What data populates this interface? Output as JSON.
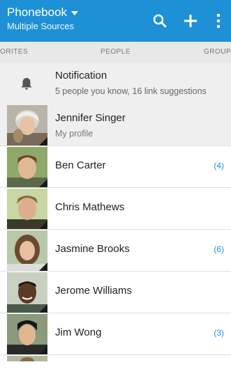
{
  "header": {
    "title": "Phonebook",
    "subtitle": "Multiple Sources",
    "actions": [
      {
        "name": "search-button",
        "icon": "search-icon"
      },
      {
        "name": "add-contact-button",
        "icon": "plus-icon"
      },
      {
        "name": "overflow-menu-button",
        "icon": "more-vert-icon"
      }
    ],
    "background": "#1e90d6"
  },
  "tabs": {
    "favorites": "ORITES",
    "people": "PEOPLE",
    "groups": "GROUP"
  },
  "notification": {
    "title": "Notification",
    "subtitle": "5 people you know, 16 link suggestions"
  },
  "contacts": [
    {
      "name": "Jennifer Singer",
      "sub": "My profile",
      "count": "",
      "avatar": "avatar-jennifer"
    },
    {
      "name": "Ben Carter",
      "sub": "",
      "count": "(4)",
      "avatar": "avatar-ben"
    },
    {
      "name": "Chris Mathews",
      "sub": "",
      "count": "",
      "avatar": "avatar-chris"
    },
    {
      "name": "Jasmine Brooks",
      "sub": "",
      "count": "(6)",
      "avatar": "avatar-jasmine"
    },
    {
      "name": "Jerome Williams",
      "sub": "",
      "count": "",
      "avatar": "avatar-jerome"
    },
    {
      "name": "Jim Wong",
      "sub": "",
      "count": "(3)",
      "avatar": "avatar-jim"
    }
  ],
  "accent": "#1e90d6"
}
